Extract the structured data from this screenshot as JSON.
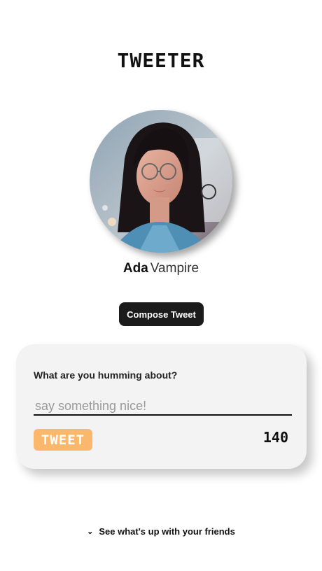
{
  "app": {
    "title": "TWEETER"
  },
  "profile": {
    "first_name": "Ada",
    "last_name": "Vampire"
  },
  "actions": {
    "compose_label": "Compose Tweet"
  },
  "compose": {
    "prompt": "What are you humming about?",
    "input_value": "",
    "input_placeholder": "say something nice!",
    "tweet_label": "TWEET",
    "char_remaining": "140"
  },
  "footer": {
    "friends_label": "See what's up with your friends",
    "chevron_icon": "chevron-down-icon"
  },
  "colors": {
    "tweet_button": "#fbb86d",
    "compose_button": "#1b1b1b",
    "card_background": "#f3f3f3"
  }
}
